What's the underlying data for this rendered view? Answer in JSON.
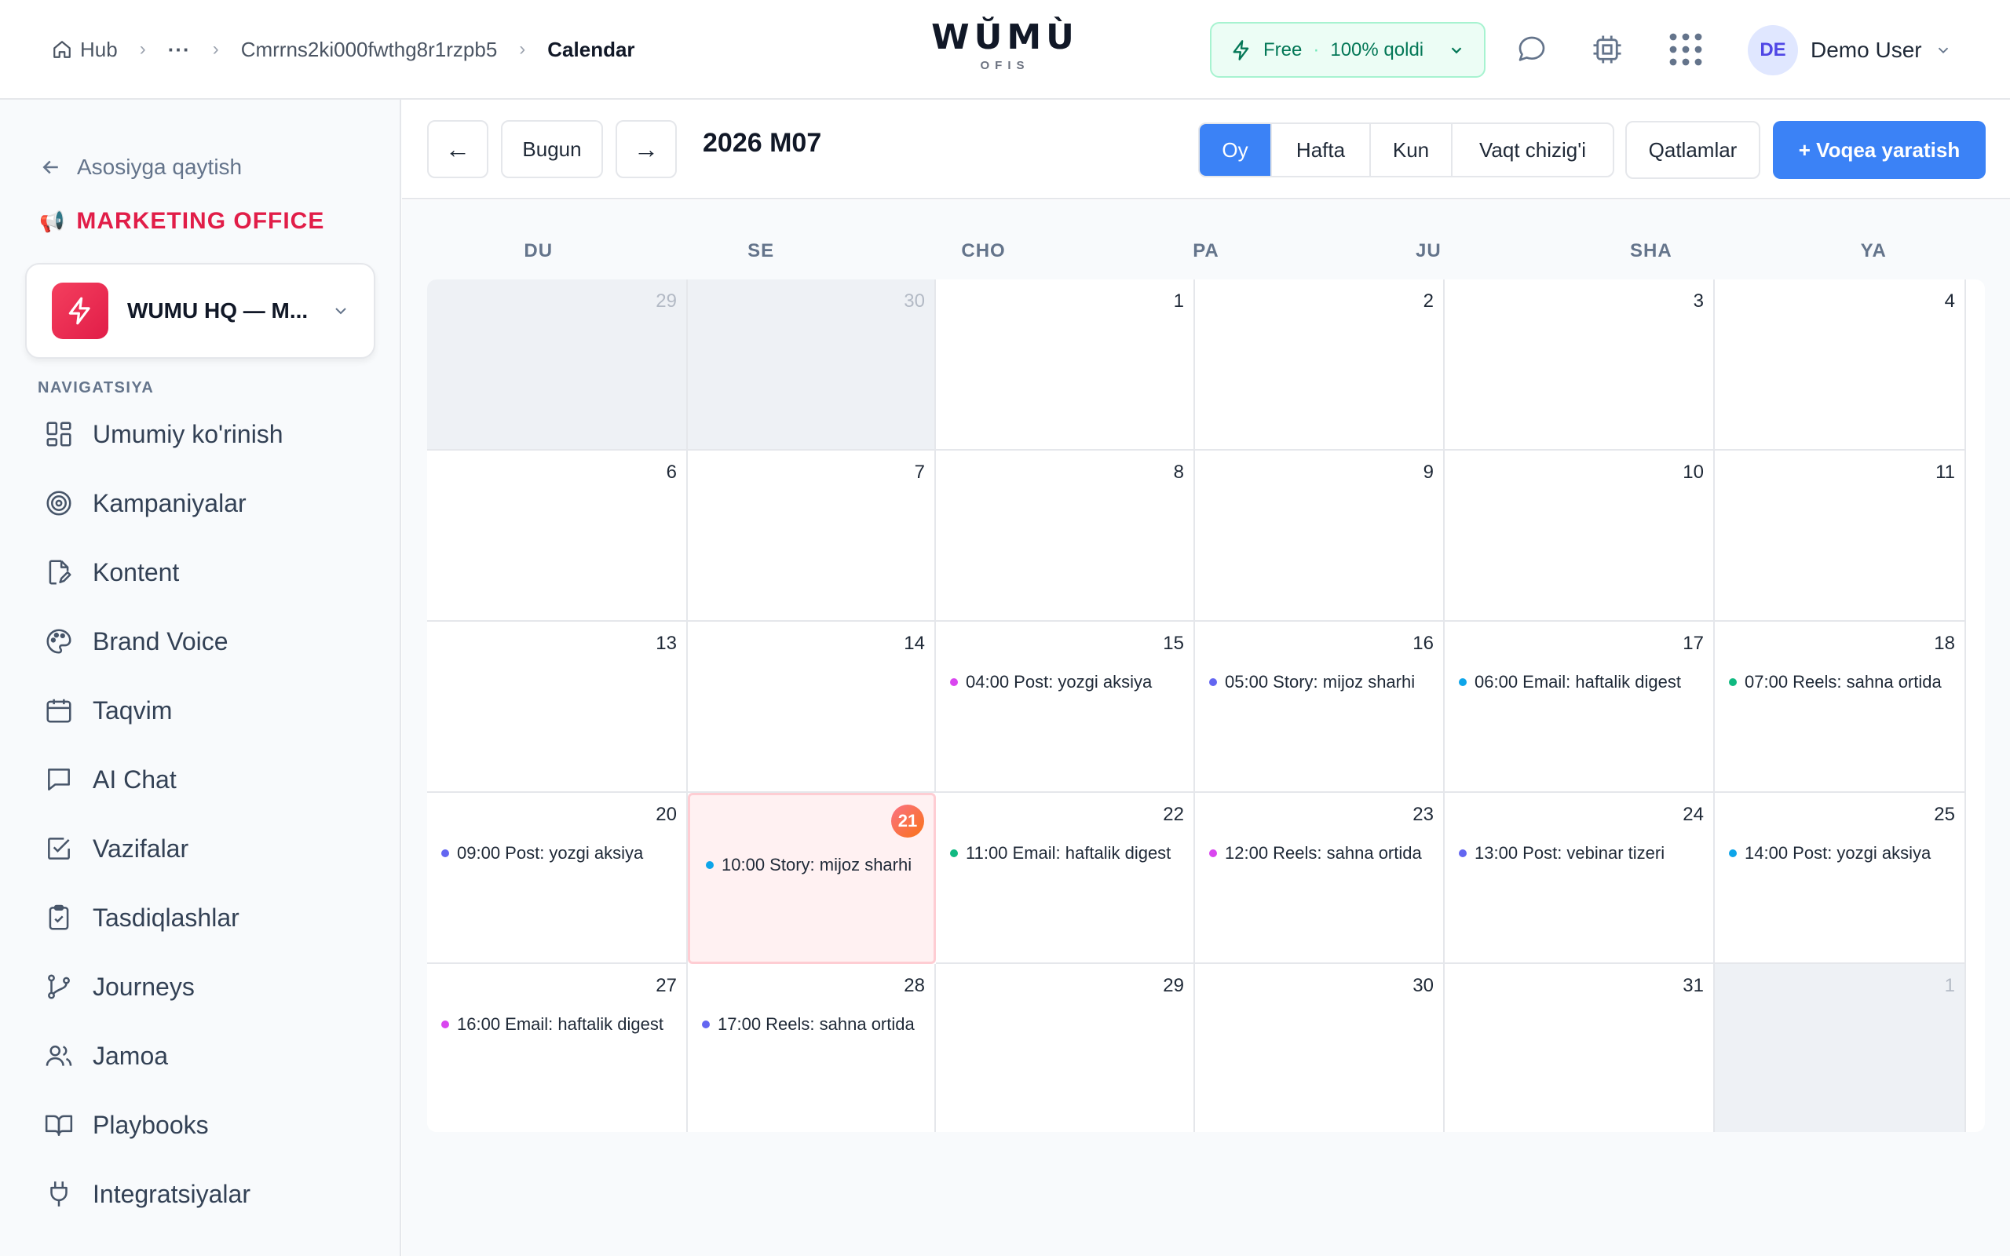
{
  "breadcrumb": {
    "home": "Hub",
    "ellipsis": "···",
    "workspace_id": "Cmrrns2ki000fwthg8r1rzpb5",
    "current": "Calendar"
  },
  "logo": {
    "word": "WŬMÙ",
    "sub": "OFIS"
  },
  "plan": {
    "name": "Free",
    "separator": "·",
    "remaining": "100% qoldi"
  },
  "user": {
    "initials": "DE",
    "name": "Demo User"
  },
  "sidebar": {
    "back": "Asosiyga qaytish",
    "office_emoji": "📢",
    "office": "MARKETING OFFICE",
    "workspace": "WUMU HQ — M...",
    "nav_header": "NAVIGATSIYA",
    "items": [
      {
        "label": "Umumiy ko'rinish",
        "icon": "dashboard-icon"
      },
      {
        "label": "Kampaniyalar",
        "icon": "target-icon"
      },
      {
        "label": "Kontent",
        "icon": "document-edit-icon"
      },
      {
        "label": "Brand Voice",
        "icon": "palette-icon"
      },
      {
        "label": "Taqvim",
        "icon": "calendar-icon"
      },
      {
        "label": "AI Chat",
        "icon": "chat-icon"
      },
      {
        "label": "Vazifalar",
        "icon": "checkbox-icon"
      },
      {
        "label": "Tasdiqlashlar",
        "icon": "clipboard-check-icon"
      },
      {
        "label": "Journeys",
        "icon": "branch-icon"
      },
      {
        "label": "Jamoa",
        "icon": "users-icon"
      },
      {
        "label": "Playbooks",
        "icon": "book-icon"
      },
      {
        "label": "Integratsiyalar",
        "icon": "plug-icon"
      }
    ]
  },
  "toolbar": {
    "prev": "←",
    "today": "Bugun",
    "next": "→",
    "title": "2026 M07",
    "views": [
      "Oy",
      "Hafta",
      "Kun",
      "Vaqt chizig'i"
    ],
    "active_view": "Oy",
    "layers": "Qatlamlar",
    "create": "+ Voqea yaratish"
  },
  "calendar": {
    "weekdays": [
      "DU",
      "SE",
      "CHO",
      "PA",
      "JU",
      "SHA",
      "YA"
    ],
    "today": "21",
    "colors": {
      "pink": "#d946ef",
      "indigo": "#6366f1",
      "sky": "#0ea5e9",
      "green": "#10b981"
    },
    "weeks": [
      [
        {
          "day": "29",
          "out": true
        },
        {
          "day": "30",
          "out": true
        },
        {
          "day": "1"
        },
        {
          "day": "2"
        },
        {
          "day": "3"
        },
        {
          "day": "4"
        }
      ],
      [
        {
          "day": "6"
        },
        {
          "day": "7"
        },
        {
          "day": "8"
        },
        {
          "day": "9"
        },
        {
          "day": "10"
        },
        {
          "day": "11"
        }
      ],
      [
        {
          "day": "13"
        },
        {
          "day": "14"
        },
        {
          "day": "15",
          "event": "04:00 Post: yozgi aksiya",
          "color": "#d946ef"
        },
        {
          "day": "16",
          "event": "05:00 Story: mijoz sharhi",
          "color": "#6366f1"
        },
        {
          "day": "17",
          "event": "06:00 Email: haftalik digest",
          "color": "#0ea5e9"
        },
        {
          "day": "18",
          "event": "07:00 Reels: sahna ortida",
          "color": "#10b981"
        }
      ],
      [
        {
          "day": "20",
          "event": "09:00 Post: yozgi aksiya",
          "color": "#6366f1"
        },
        {
          "day": "21",
          "event": "10:00 Story: mijoz sharhi",
          "color": "#0ea5e9",
          "today": true
        },
        {
          "day": "22",
          "event": "11:00 Email: haftalik digest",
          "color": "#10b981"
        },
        {
          "day": "23",
          "event": "12:00 Reels: sahna ortida",
          "color": "#d946ef"
        },
        {
          "day": "24",
          "event": "13:00 Post: vebinar tizeri",
          "color": "#6366f1"
        },
        {
          "day": "25",
          "event": "14:00 Post: yozgi aksiya",
          "color": "#0ea5e9"
        }
      ],
      [
        {
          "day": "27",
          "event": "16:00 Email: haftalik digest",
          "color": "#d946ef"
        },
        {
          "day": "28",
          "event": "17:00 Reels: sahna ortida",
          "color": "#6366f1"
        },
        {
          "day": "29"
        },
        {
          "day": "30"
        },
        {
          "day": "31"
        },
        {
          "day": "1",
          "out": true
        }
      ]
    ]
  }
}
